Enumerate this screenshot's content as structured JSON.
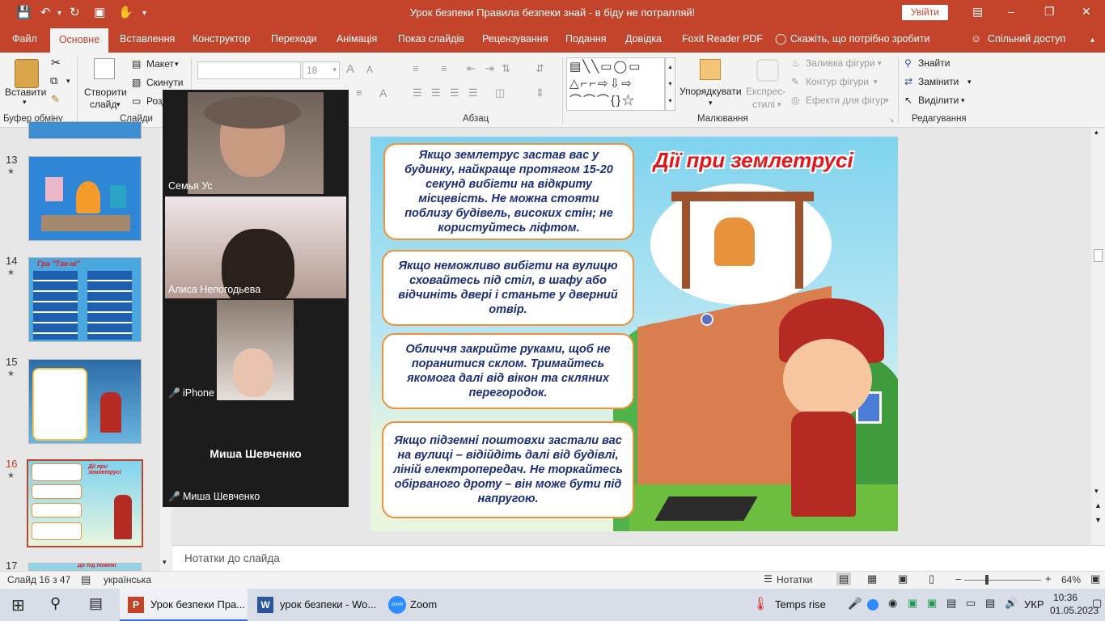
{
  "app": {
    "title": "Урок безпеки Правила безпеки знай - в біду не потрапляй!",
    "signin": "Увійти"
  },
  "menu": {
    "items": [
      "Файл",
      "Основне",
      "Вставлення",
      "Конструктор",
      "Переходи",
      "Анімація",
      "Показ слайдів",
      "Рецензування",
      "Подання",
      "Довідка",
      "Foxit Reader PDF",
      "Скажіть, що потрібно зробити",
      "Спільний доступ"
    ]
  },
  "ribbon": {
    "paste": "Вставити",
    "clipboard_group": "Буфер обміну",
    "new_slide_line1": "Створити",
    "new_slide_line2": "слайд",
    "layout": "Макет",
    "reset": "Скинути",
    "section": "Розділ",
    "slides_group": "Слайди",
    "font_size": "18",
    "paragraph_group": "Абзац",
    "arrange": "Упорядкувати",
    "quick_styles_line1": "Експрес-",
    "quick_styles_line2": "стилі",
    "shape_fill": "Заливка фігури",
    "shape_outline": "Контур фігури",
    "shape_effects": "Ефекти для фігур",
    "drawing_group": "Малювання",
    "find": "Знайти",
    "replace": "Замінити",
    "select": "Виділити",
    "editing_group": "Редагування"
  },
  "thumbnails": [
    {
      "num": "13",
      "star": "★",
      "title": ""
    },
    {
      "num": "14",
      "star": "★",
      "title": "Гра \"Так-ні\""
    },
    {
      "num": "15",
      "star": "★",
      "title": ""
    },
    {
      "num": "16",
      "star": "★",
      "title": "Дії при землетрусі"
    },
    {
      "num": "17",
      "star": "",
      "title": "Дії під пожежі"
    }
  ],
  "slide": {
    "title": "Дії при землетрусі",
    "boxes": [
      "Якщо землетрус застав вас у будинку, найкраще протягом 15-20 секунд вибігти на відкриту місцевість. Не можна стояти поблизу будівель, високих стін; не користуйтесь ліфтом.",
      "Якщо неможливо вибігти на вулицю сховайтесь під стіл, в шафу або відчиніть двері і станьте у дверний отвір.",
      "Обличчя закрийте руками, щоб не поранитися склом. Тримайтесь якомога далі  від вікон та скляних перегородок.",
      "Якщо підземні поштовхи застали вас на вулиці – відійдіть далі від будівлі, ліній електропередач. Не торкайтесь обірваного дроту – він може бути під напругою."
    ]
  },
  "notes_placeholder": "Нотатки до слайда",
  "zoom": {
    "participants": [
      {
        "name": "Семья Ус",
        "muted": false
      },
      {
        "name": "Алиса Непогодьева",
        "muted": false
      },
      {
        "name": "iPhone",
        "muted": true
      },
      {
        "name": "Миша Шевченко",
        "muted": true
      }
    ],
    "camera_off_name": "Миша Шевченко"
  },
  "status": {
    "slide_info": "Слайд 16 з 47",
    "language": "українська",
    "notes": "Нотатки",
    "zoom": "64%"
  },
  "taskbar": {
    "apps": [
      "Урок безпеки Пра...",
      "урок безпеки - Wo...",
      "Zoom"
    ],
    "weather": "Temps rise",
    "lang": "УКР",
    "time": "10:36",
    "date": "01.05.2023"
  },
  "colors": {
    "accent": "#c4442b",
    "slide_text": "#1b2e7a",
    "slide_title": "#e3161b",
    "box_border": "#f0923a"
  }
}
